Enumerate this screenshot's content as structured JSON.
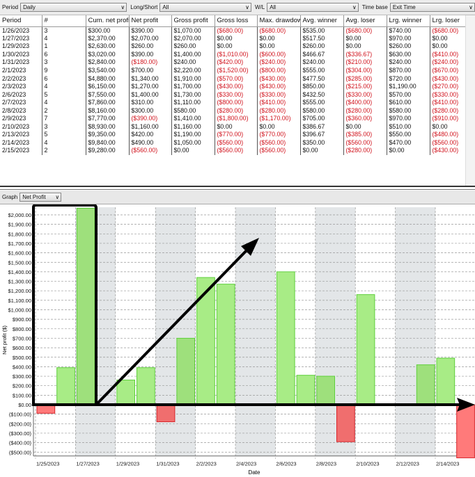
{
  "filters": {
    "period_label": "Period",
    "period_value": "Daily",
    "longshort_label": "Long/Short",
    "longshort_value": "All",
    "wl_label": "W/L",
    "wl_value": "All",
    "timebase_label": "Time base",
    "timebase_value": "Exit Time"
  },
  "table": {
    "columns": [
      "Period",
      "#",
      "Cum. net profi",
      "Net profit",
      "Gross profit",
      "Gross loss",
      "Max. drawdow",
      "Avg. winner",
      "Avg. loser",
      "Lrg. winner",
      "Lrg. loser"
    ],
    "rows": [
      [
        "1/26/2023",
        "3",
        "$300.00",
        "$390.00",
        "$1,070.00",
        "($680.00)",
        "($680.00)",
        "$535.00",
        "($680.00)",
        "$740.00",
        "($680.00)"
      ],
      [
        "1/27/2023",
        "4",
        "$2,370.00",
        "$2,070.00",
        "$2,070.00",
        "$0.00",
        "$0.00",
        "$517.50",
        "$0.00",
        "$970.00",
        "$0.00"
      ],
      [
        "1/29/2023",
        "1",
        "$2,630.00",
        "$260.00",
        "$260.00",
        "$0.00",
        "$0.00",
        "$260.00",
        "$0.00",
        "$260.00",
        "$0.00"
      ],
      [
        "1/30/2023",
        "6",
        "$3,020.00",
        "$390.00",
        "$1,400.00",
        "($1,010.00)",
        "($600.00)",
        "$466.67",
        "($336.67)",
        "$630.00",
        "($410.00)"
      ],
      [
        "1/31/2023",
        "3",
        "$2,840.00",
        "($180.00)",
        "$240.00",
        "($420.00)",
        "($240.00)",
        "$240.00",
        "($210.00)",
        "$240.00",
        "($240.00)"
      ],
      [
        "2/1/2023",
        "9",
        "$3,540.00",
        "$700.00",
        "$2,220.00",
        "($1,520.00)",
        "($800.00)",
        "$555.00",
        "($304.00)",
        "$870.00",
        "($670.00)"
      ],
      [
        "2/2/2023",
        "6",
        "$4,880.00",
        "$1,340.00",
        "$1,910.00",
        "($570.00)",
        "($430.00)",
        "$477.50",
        "($285.00)",
        "$720.00",
        "($430.00)"
      ],
      [
        "2/3/2023",
        "4",
        "$6,150.00",
        "$1,270.00",
        "$1,700.00",
        "($430.00)",
        "($430.00)",
        "$850.00",
        "($215.00)",
        "$1,190.00",
        "($270.00)"
      ],
      [
        "2/6/2023",
        "5",
        "$7,550.00",
        "$1,400.00",
        "$1,730.00",
        "($330.00)",
        "($330.00)",
        "$432.50",
        "($330.00)",
        "$570.00",
        "($330.00)"
      ],
      [
        "2/7/2023",
        "4",
        "$7,860.00",
        "$310.00",
        "$1,110.00",
        "($800.00)",
        "($410.00)",
        "$555.00",
        "($400.00)",
        "$610.00",
        "($410.00)"
      ],
      [
        "2/8/2023",
        "2",
        "$8,160.00",
        "$300.00",
        "$580.00",
        "($280.00)",
        "($280.00)",
        "$580.00",
        "($280.00)",
        "$580.00",
        "($280.00)"
      ],
      [
        "2/9/2023",
        "7",
        "$7,770.00",
        "($390.00)",
        "$1,410.00",
        "($1,800.00)",
        "($1,170.00)",
        "$705.00",
        "($360.00)",
        "$970.00",
        "($910.00)"
      ],
      [
        "2/10/2023",
        "3",
        "$8,930.00",
        "$1,160.00",
        "$1,160.00",
        "$0.00",
        "$0.00",
        "$386.67",
        "$0.00",
        "$510.00",
        "$0.00"
      ],
      [
        "2/13/2023",
        "5",
        "$9,350.00",
        "$420.00",
        "$1,190.00",
        "($770.00)",
        "($770.00)",
        "$396.67",
        "($385.00)",
        "$550.00",
        "($480.00)"
      ],
      [
        "2/14/2023",
        "4",
        "$9,840.00",
        "$490.00",
        "$1,050.00",
        "($560.00)",
        "($560.00)",
        "$350.00",
        "($560.00)",
        "$470.00",
        "($560.00)"
      ],
      [
        "2/15/2023",
        "2",
        "$9,280.00",
        "($560.00)",
        "$0.00",
        "($560.00)",
        "($560.00)",
        "$0.00",
        "($280.00)",
        "$0.00",
        "($430.00)"
      ]
    ]
  },
  "graph": {
    "label": "Graph",
    "value": "Net Profit"
  },
  "chart_data": {
    "type": "bar",
    "xlabel": "Date",
    "ylabel": "Net profit ($)",
    "ylim": [
      -540,
      2080
    ],
    "grid": true,
    "x_ticks": [
      "1/25/2023",
      "1/27/2023",
      "1/29/2023",
      "1/31/2023",
      "2/2/2023",
      "2/4/2023",
      "2/6/2023",
      "2/8/2023",
      "2/10/2023",
      "2/12/2023",
      "2/14/2023"
    ],
    "y_ticks": [
      "($500.00)",
      "($400.00)",
      "($300.00)",
      "($200.00)",
      "($100.00)",
      "$0.00",
      "$100.00",
      "$200.00",
      "$300.00",
      "$400.00",
      "$500.00",
      "$600.00",
      "$700.00",
      "$800.00",
      "$900.00",
      "$1,000.00",
      "$1,100.00",
      "$1,200.00",
      "$1,300.00",
      "$1,400.00",
      "$1,500.00",
      "$1,600.00",
      "$1,700.00",
      "$1,800.00",
      "$1,900.00",
      "$2,000.00"
    ],
    "categories": [
      "1/25/2023",
      "1/26/2023",
      "1/27/2023",
      "1/28/2023",
      "1/29/2023",
      "1/30/2023",
      "1/31/2023",
      "2/1/2023",
      "2/2/2023",
      "2/3/2023",
      "2/4/2023",
      "2/5/2023",
      "2/6/2023",
      "2/7/2023",
      "2/8/2023",
      "2/9/2023",
      "2/10/2023",
      "2/11/2023",
      "2/12/2023",
      "2/13/2023",
      "2/14/2023",
      "2/15/2023"
    ],
    "values": [
      -90,
      390,
      2070,
      null,
      260,
      390,
      -180,
      700,
      1340,
      1270,
      null,
      null,
      1400,
      310,
      300,
      -390,
      1160,
      null,
      null,
      420,
      490,
      -560
    ],
    "colors": {
      "positive": "#a8ec86",
      "positive_border": "#5fcf3c",
      "negative": "#ff7a7a",
      "negative_border": "#d8242a",
      "band": "#e3e6e8"
    }
  }
}
